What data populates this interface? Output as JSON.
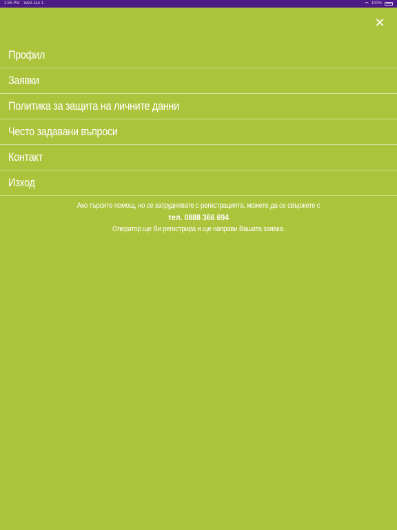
{
  "status_bar": {
    "time": "2:55 PM",
    "date": "Wed Jan 1",
    "battery": "100%"
  },
  "icons": {
    "close": "close-icon",
    "wifi": "wifi-icon",
    "battery": "battery-icon"
  },
  "menu": {
    "items": [
      {
        "label": "Профил"
      },
      {
        "label": "Заявки"
      },
      {
        "label": "Политика за защита на личните данни"
      },
      {
        "label": "Често задавани въпроси"
      },
      {
        "label": "Контакт"
      },
      {
        "label": "Изход"
      }
    ]
  },
  "help": {
    "line1": "Ако търсите помощ, но се затруднявате с регистрацията, можете да се свържете с",
    "phone": "тел. 0888 366 694",
    "line3": "Оператор ще Ви регистрира и ще направи Вашата заявка."
  },
  "colors": {
    "background": "#abc43b",
    "status_bar": "#4c1b86",
    "text": "#ffffff",
    "divider": "#d4e29a"
  }
}
